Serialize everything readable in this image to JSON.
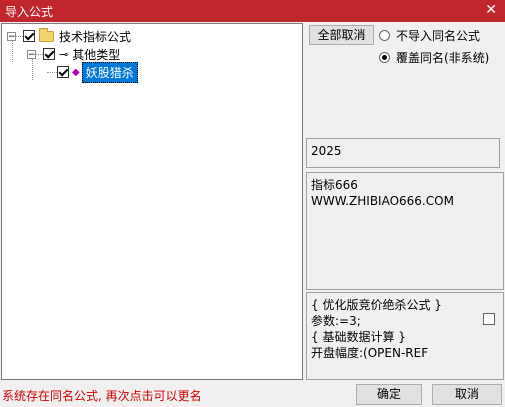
{
  "window": {
    "title": "导入公式",
    "close_glyph": "✕"
  },
  "tree": {
    "root_label": "技术指标公式",
    "child_label": "其他类型",
    "leaf_label": "妖股猎杀"
  },
  "buttons": {
    "cancel_all": "全部取消",
    "ok": "确定",
    "cancel": "取消"
  },
  "options": {
    "no_import": "不导入同名公式",
    "overwrite": "覆盖同名(非系统)",
    "selected": "overwrite"
  },
  "info": {
    "year": "2025",
    "description": "指标666\nWWW.ZHIBIAO666.COM",
    "formula": "{ 优化版竞价绝杀公式 }\n参数:=3;\n{ 基础数据计算 }\n开盘幅度:(OPEN-REF"
  },
  "status_text": "系统存在同名公式, 再次点击可以更名"
}
